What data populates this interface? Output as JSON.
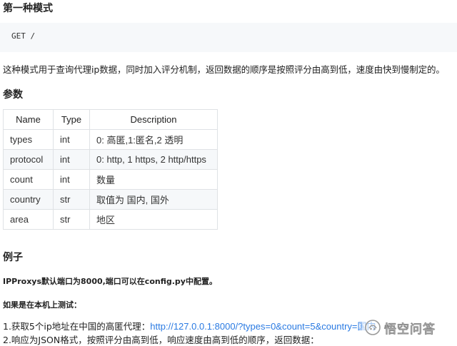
{
  "sections": {
    "mode_title": "第一种模式",
    "params_title": "参数",
    "example_title": "例子"
  },
  "code": {
    "text": "GET /"
  },
  "description": "这种模式用于查询代理ip数据，同时加入评分机制，返回数据的顺序是按照评分由高到低，速度由快到慢制定的。",
  "table": {
    "headers": [
      "Name",
      "Type",
      "Description"
    ],
    "rows": [
      [
        "types",
        "int",
        "0: 高匿,1:匿名,2 透明"
      ],
      [
        "protocol",
        "int",
        "0: http, 1 https, 2 http/https"
      ],
      [
        "count",
        "int",
        "数量"
      ],
      [
        "country",
        "str",
        "取值为 国内, 国外"
      ],
      [
        "area",
        "str",
        "地区"
      ]
    ]
  },
  "example": {
    "port_note": "IPProxys默认端口为8000,端口可以在config.py中配置。",
    "local_note": "如果是在本机上测试：",
    "step1_prefix": "1.获取5个ip地址在中国的高匿代理：",
    "step1_link": "http://127.0.0.1:8000/?types=0&count=5&country=国内",
    "step2": "2.响应为JSON格式，按照评分由高到低，响应速度由高到低的顺序，返回数据："
  },
  "watermark": {
    "text": "悟空问答",
    "icon": "wukong-logo-icon"
  }
}
